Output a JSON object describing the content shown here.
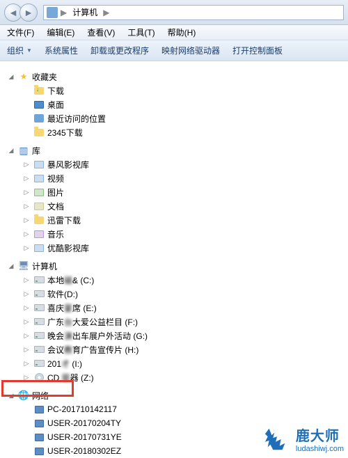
{
  "addressbar": {
    "root": "计算机",
    "sep": "▶"
  },
  "menu": {
    "file": "文件(F)",
    "edit": "编辑(E)",
    "view": "查看(V)",
    "tools": "工具(T)",
    "help": "帮助(H)"
  },
  "toolbar": {
    "organize": "组织",
    "properties": "系统属性",
    "uninstall": "卸载或更改程序",
    "mapdrive": "映射网络驱动器",
    "controlpanel": "打开控制面板"
  },
  "tree": {
    "favorites": {
      "label": "收藏夹",
      "items": [
        {
          "icon": "download",
          "label": "下载"
        },
        {
          "icon": "desktop",
          "label": "桌面"
        },
        {
          "icon": "recent",
          "label": "最近访问的位置"
        },
        {
          "icon": "folder",
          "label": "2345下载"
        }
      ]
    },
    "libraries": {
      "label": "库",
      "items": [
        {
          "icon": "video",
          "label": "暴风影视库"
        },
        {
          "icon": "video",
          "label": "视频"
        },
        {
          "icon": "pic",
          "label": "图片"
        },
        {
          "icon": "doc",
          "label": "文档"
        },
        {
          "icon": "folder",
          "label": "迅雷下载"
        },
        {
          "icon": "music",
          "label": "音乐"
        },
        {
          "icon": "video",
          "label": "优酷影视库"
        }
      ]
    },
    "computer": {
      "label": "计算机",
      "items": [
        {
          "icon": "drive",
          "label_pre": "本地",
          "label_blur": "磁",
          "label_post": "& (C:)"
        },
        {
          "icon": "drive",
          "label_pre": "软件",
          "label_blur": "",
          "label_post": "(D:)"
        },
        {
          "icon": "drive",
          "label_pre": "喜庆",
          "label_blur": "宴",
          "label_post": "席 (E:)"
        },
        {
          "icon": "drive",
          "label_pre": "广东",
          "label_blur": "台",
          "label_post": "大爱公益栏目 (F:)"
        },
        {
          "icon": "drive",
          "label_pre": "晚会",
          "label_blur": "演",
          "label_post": "出车展户外活动 (G:)"
        },
        {
          "icon": "drive",
          "label_pre": "会议",
          "label_blur": "教",
          "label_post": "育广告宣传片 (H:)"
        },
        {
          "icon": "drive",
          "label_pre": "201",
          "label_blur": "才",
          "label_post": " (I:)"
        },
        {
          "icon": "cd",
          "label_pre": "CD ",
          "label_blur": "驱",
          "label_post": "器 (Z:)"
        }
      ]
    },
    "network": {
      "label": "网络",
      "items": [
        {
          "icon": "pc",
          "label": "PC-201710142117"
        },
        {
          "icon": "pc",
          "label": "USER-20170204TY"
        },
        {
          "icon": "pc",
          "label": "USER-20170731YE"
        },
        {
          "icon": "pc",
          "label": "USER-20180302EZ"
        }
      ]
    }
  },
  "watermark": {
    "brand": "鹿大师",
    "url": "ludashiwj.com"
  },
  "glyph": {
    "tw_open": "◢",
    "tw_closed": "▷"
  }
}
